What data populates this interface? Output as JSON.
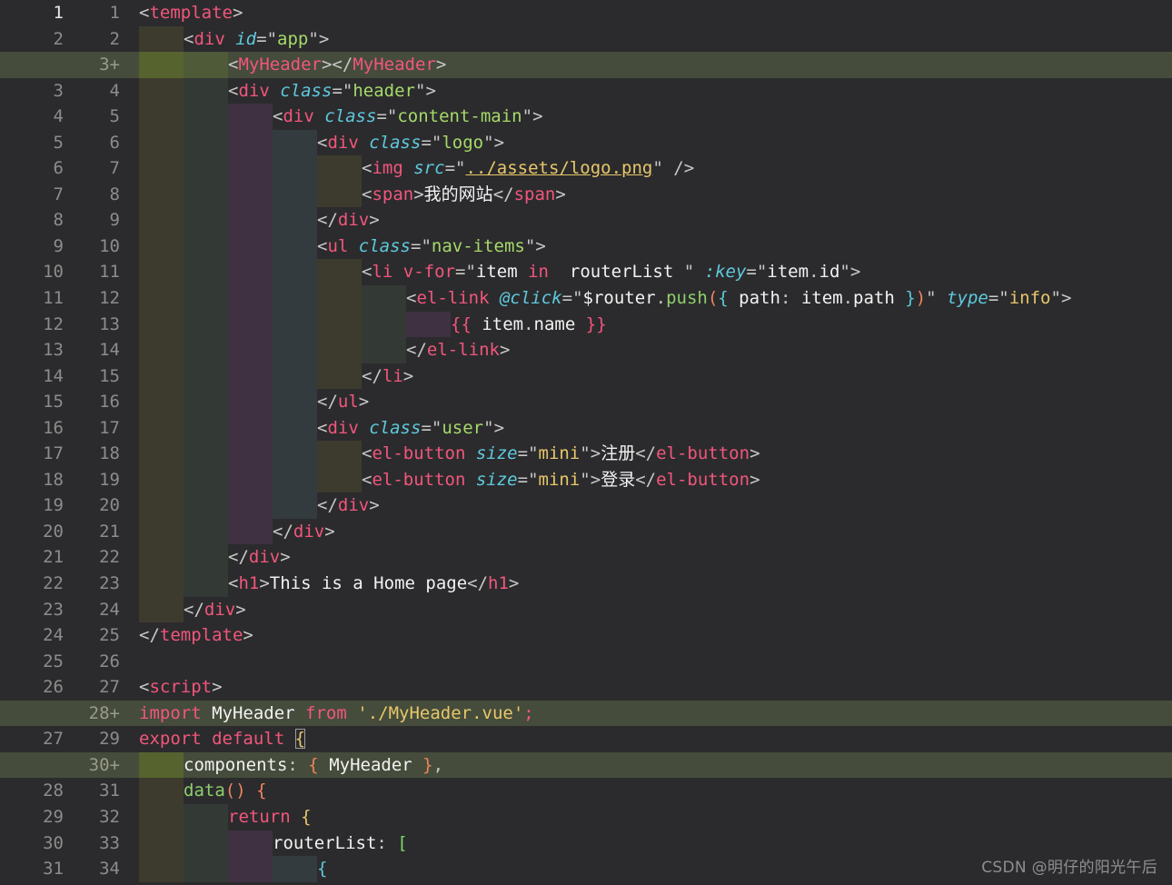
{
  "editor": {
    "theme_background": "#2b2b2d",
    "added_line_background": "#454c3b",
    "accent_tag_color": "#f2567c",
    "accent_attr_color": "#5ec9dd",
    "accent_string_color": "#a6d96a",
    "language": "vue",
    "diff_marker": "+"
  },
  "watermark": {
    "text": "CSDN @明仔的阳光午后"
  },
  "lines": [
    {
      "old": "1",
      "new": "1",
      "added": false,
      "indent": 0,
      "current": true,
      "text": "<template>"
    },
    {
      "old": "2",
      "new": "2",
      "added": false,
      "indent": 1,
      "text": "<div id=\"app\">"
    },
    {
      "old": "",
      "new": "3+",
      "added": true,
      "indent": 2,
      "text": "<MyHeader></MyHeader>"
    },
    {
      "old": "3",
      "new": "4",
      "added": false,
      "indent": 2,
      "text": "<div class=\"header\">"
    },
    {
      "old": "4",
      "new": "5",
      "added": false,
      "indent": 3,
      "text": "<div class=\"content-main\">"
    },
    {
      "old": "5",
      "new": "6",
      "added": false,
      "indent": 4,
      "text": "<div class=\"logo\">"
    },
    {
      "old": "6",
      "new": "7",
      "added": false,
      "indent": 5,
      "text": "<img src=\"../assets/logo.png\" />"
    },
    {
      "old": "7",
      "new": "8",
      "added": false,
      "indent": 5,
      "text": "<span>我的网站</span>"
    },
    {
      "old": "8",
      "new": "9",
      "added": false,
      "indent": 4,
      "text": "</div>"
    },
    {
      "old": "9",
      "new": "10",
      "added": false,
      "indent": 4,
      "text": "<ul class=\"nav-items\">"
    },
    {
      "old": "10",
      "new": "11",
      "added": false,
      "indent": 5,
      "text": "<li v-for=\"item in  routerList \" :key=\"item.id\">"
    },
    {
      "old": "11",
      "new": "12",
      "added": false,
      "indent": 6,
      "text": "<el-link @click=\"$router.push({ path: item.path })\" type=\"info\">"
    },
    {
      "old": "12",
      "new": "13",
      "added": false,
      "indent": 7,
      "text": "{{ item.name }}"
    },
    {
      "old": "13",
      "new": "14",
      "added": false,
      "indent": 6,
      "text": "</el-link>"
    },
    {
      "old": "14",
      "new": "15",
      "added": false,
      "indent": 5,
      "text": "</li>"
    },
    {
      "old": "15",
      "new": "16",
      "added": false,
      "indent": 4,
      "text": "</ul>"
    },
    {
      "old": "16",
      "new": "17",
      "added": false,
      "indent": 4,
      "text": "<div class=\"user\">"
    },
    {
      "old": "17",
      "new": "18",
      "added": false,
      "indent": 5,
      "text": "<el-button size=\"mini\">注册</el-button>"
    },
    {
      "old": "18",
      "new": "19",
      "added": false,
      "indent": 5,
      "text": "<el-button size=\"mini\">登录</el-button>"
    },
    {
      "old": "19",
      "new": "20",
      "added": false,
      "indent": 4,
      "text": "</div>"
    },
    {
      "old": "20",
      "new": "21",
      "added": false,
      "indent": 3,
      "text": "</div>"
    },
    {
      "old": "21",
      "new": "22",
      "added": false,
      "indent": 2,
      "text": "</div>"
    },
    {
      "old": "22",
      "new": "23",
      "added": false,
      "indent": 2,
      "text": "<h1>This is a Home page</h1>"
    },
    {
      "old": "23",
      "new": "24",
      "added": false,
      "indent": 1,
      "text": "</div>"
    },
    {
      "old": "24",
      "new": "25",
      "added": false,
      "indent": 0,
      "text": "</template>"
    },
    {
      "old": "25",
      "new": "26",
      "added": false,
      "indent": 0,
      "text": ""
    },
    {
      "old": "26",
      "new": "27",
      "added": false,
      "indent": 0,
      "text": "<script>"
    },
    {
      "old": "",
      "new": "28+",
      "added": true,
      "indent": 0,
      "text": "import MyHeader from './MyHeader.vue';"
    },
    {
      "old": "27",
      "new": "29",
      "added": false,
      "indent": 0,
      "text": "export default {"
    },
    {
      "old": "",
      "new": "30+",
      "added": true,
      "indent": 1,
      "text": "components: { MyHeader },"
    },
    {
      "old": "28",
      "new": "31",
      "added": false,
      "indent": 1,
      "text": "data() {"
    },
    {
      "old": "29",
      "new": "32",
      "added": false,
      "indent": 2,
      "text": "return {"
    },
    {
      "old": "30",
      "new": "33",
      "added": false,
      "indent": 3,
      "text": "routerList: ["
    },
    {
      "old": "31",
      "new": "34",
      "added": false,
      "indent": 4,
      "text": "{"
    }
  ]
}
